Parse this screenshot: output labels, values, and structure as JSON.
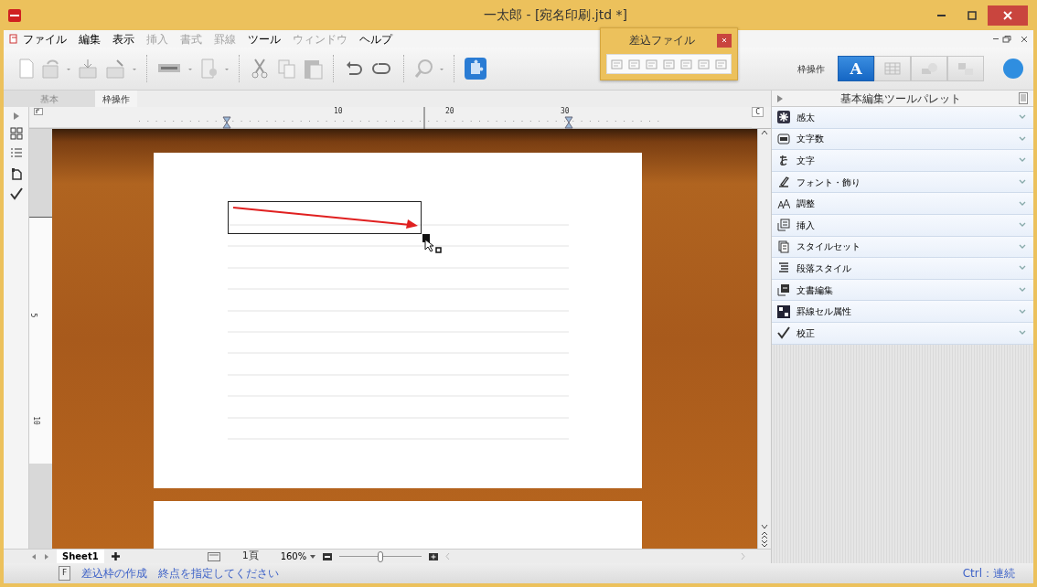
{
  "window": {
    "title": "一太郎 - [宛名印刷.jtd *]"
  },
  "menu": [
    {
      "label": "ファイル",
      "disabled": false
    },
    {
      "label": "編集",
      "disabled": false
    },
    {
      "label": "表示",
      "disabled": false
    },
    {
      "label": "挿入",
      "disabled": true
    },
    {
      "label": "書式",
      "disabled": true
    },
    {
      "label": "罫線",
      "disabled": true
    },
    {
      "label": "ツール",
      "disabled": false
    },
    {
      "label": "ウィンドウ",
      "disabled": true
    },
    {
      "label": "ヘルプ",
      "disabled": false
    }
  ],
  "frame_tools": {
    "label": "枠操作",
    "modes": [
      {
        "label": "A",
        "selected": true
      },
      {
        "selected": false
      },
      {
        "selected": false
      },
      {
        "selected": false
      }
    ]
  },
  "merge_panel": {
    "title": "差込ファイル"
  },
  "tabs": [
    {
      "label": "基本",
      "selected": false
    },
    {
      "label": "枠操作",
      "selected": true
    }
  ],
  "ruler": {
    "h_labels": [
      "10",
      "20",
      "30"
    ],
    "corner": "C",
    "v_labels": [
      "5",
      "10"
    ]
  },
  "palette": {
    "title": "基本編集ツールパレット",
    "sections": [
      {
        "label": "感太"
      },
      {
        "label": "文字数"
      },
      {
        "label": "文字"
      },
      {
        "label": "フォント・飾り"
      },
      {
        "label": "調整"
      },
      {
        "label": "挿入"
      },
      {
        "label": "スタイルセット"
      },
      {
        "label": "段落スタイル"
      },
      {
        "label": "文書編集"
      },
      {
        "label": "罫線セル属性"
      },
      {
        "label": "校正"
      }
    ]
  },
  "bottom_bar": {
    "sheet": "Sheet1",
    "page": "1頁",
    "zoom": "160%",
    "zoom_slider": {
      "level": 0.5
    }
  },
  "status": {
    "key": "F",
    "mode": "差込枠の作成",
    "message": "終点を指定してください",
    "hint": "Ctrl：連続"
  }
}
